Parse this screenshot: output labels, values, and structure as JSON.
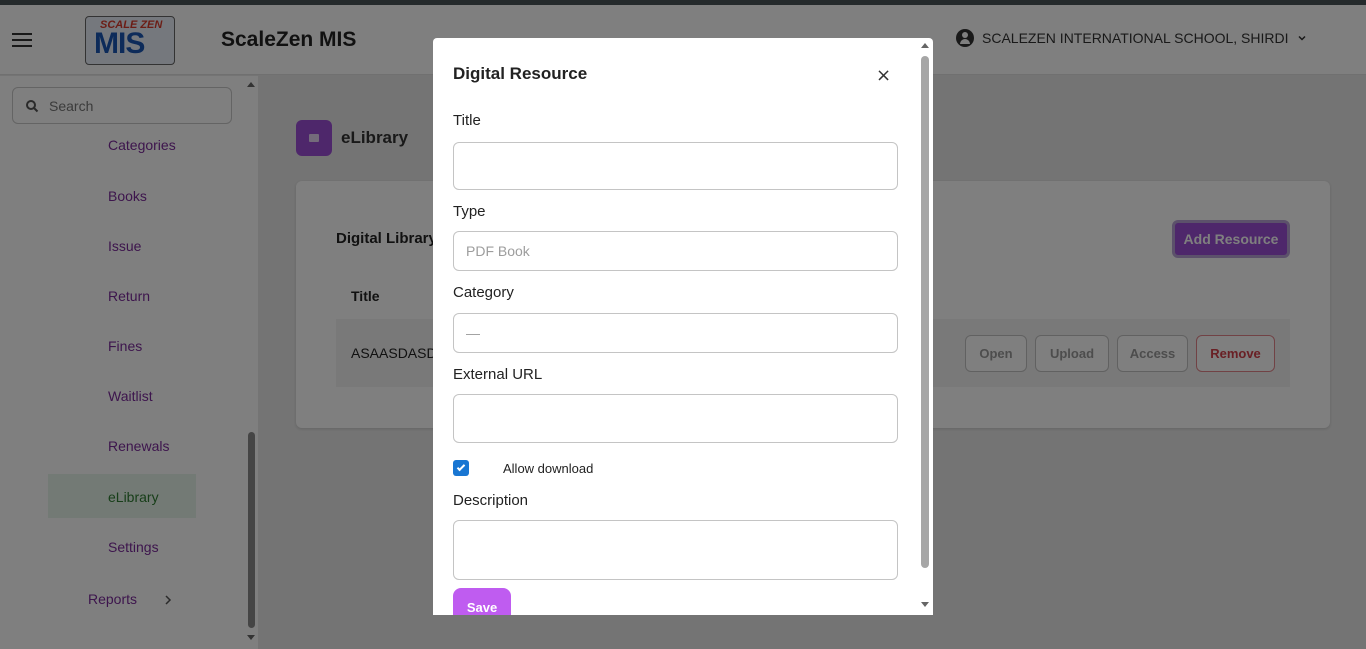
{
  "app": {
    "title": "ScaleZen MIS",
    "logo_top": "SCALE ZEN",
    "logo_main": "MIS"
  },
  "header": {
    "school": "SCALEZEN INTERNATIONAL SCHOOL, SHIRDI"
  },
  "sidebar": {
    "search_placeholder": "Search",
    "items": [
      {
        "label": "Categories"
      },
      {
        "label": "Books"
      },
      {
        "label": "Issue"
      },
      {
        "label": "Return"
      },
      {
        "label": "Fines"
      },
      {
        "label": "Waitlist"
      },
      {
        "label": "Renewals"
      },
      {
        "label": "eLibrary"
      },
      {
        "label": "Settings"
      }
    ],
    "reports": "Reports"
  },
  "main": {
    "title": "eLibrary",
    "card_title": "Digital Library",
    "add_button": "Add Resource",
    "table_header_title": "Title",
    "rows": [
      {
        "title": "ASAASDASD",
        "open": "Open",
        "upload": "Upload",
        "access": "Access",
        "remove": "Remove"
      }
    ]
  },
  "modal": {
    "title": "Digital Resource",
    "close": "×",
    "title_label": "Title",
    "title_value": "",
    "type_label": "Type",
    "type_placeholder": "PDF Book",
    "category_label": "Category",
    "category_placeholder": "—",
    "url_label": "External URL",
    "url_value": "",
    "allow_download_label": "Allow download",
    "allow_download_checked": true,
    "description_label": "Description",
    "description_value": "",
    "save_button": "Save"
  },
  "colors": {
    "accent": "#9c4fd6",
    "nav_text": "#7b2a9a",
    "active_bg": "#e6f4ea",
    "active_text": "#2e7d32",
    "save_bg": "#bf5cf0",
    "checkbox": "#1976d2",
    "remove": "#d2404a"
  }
}
